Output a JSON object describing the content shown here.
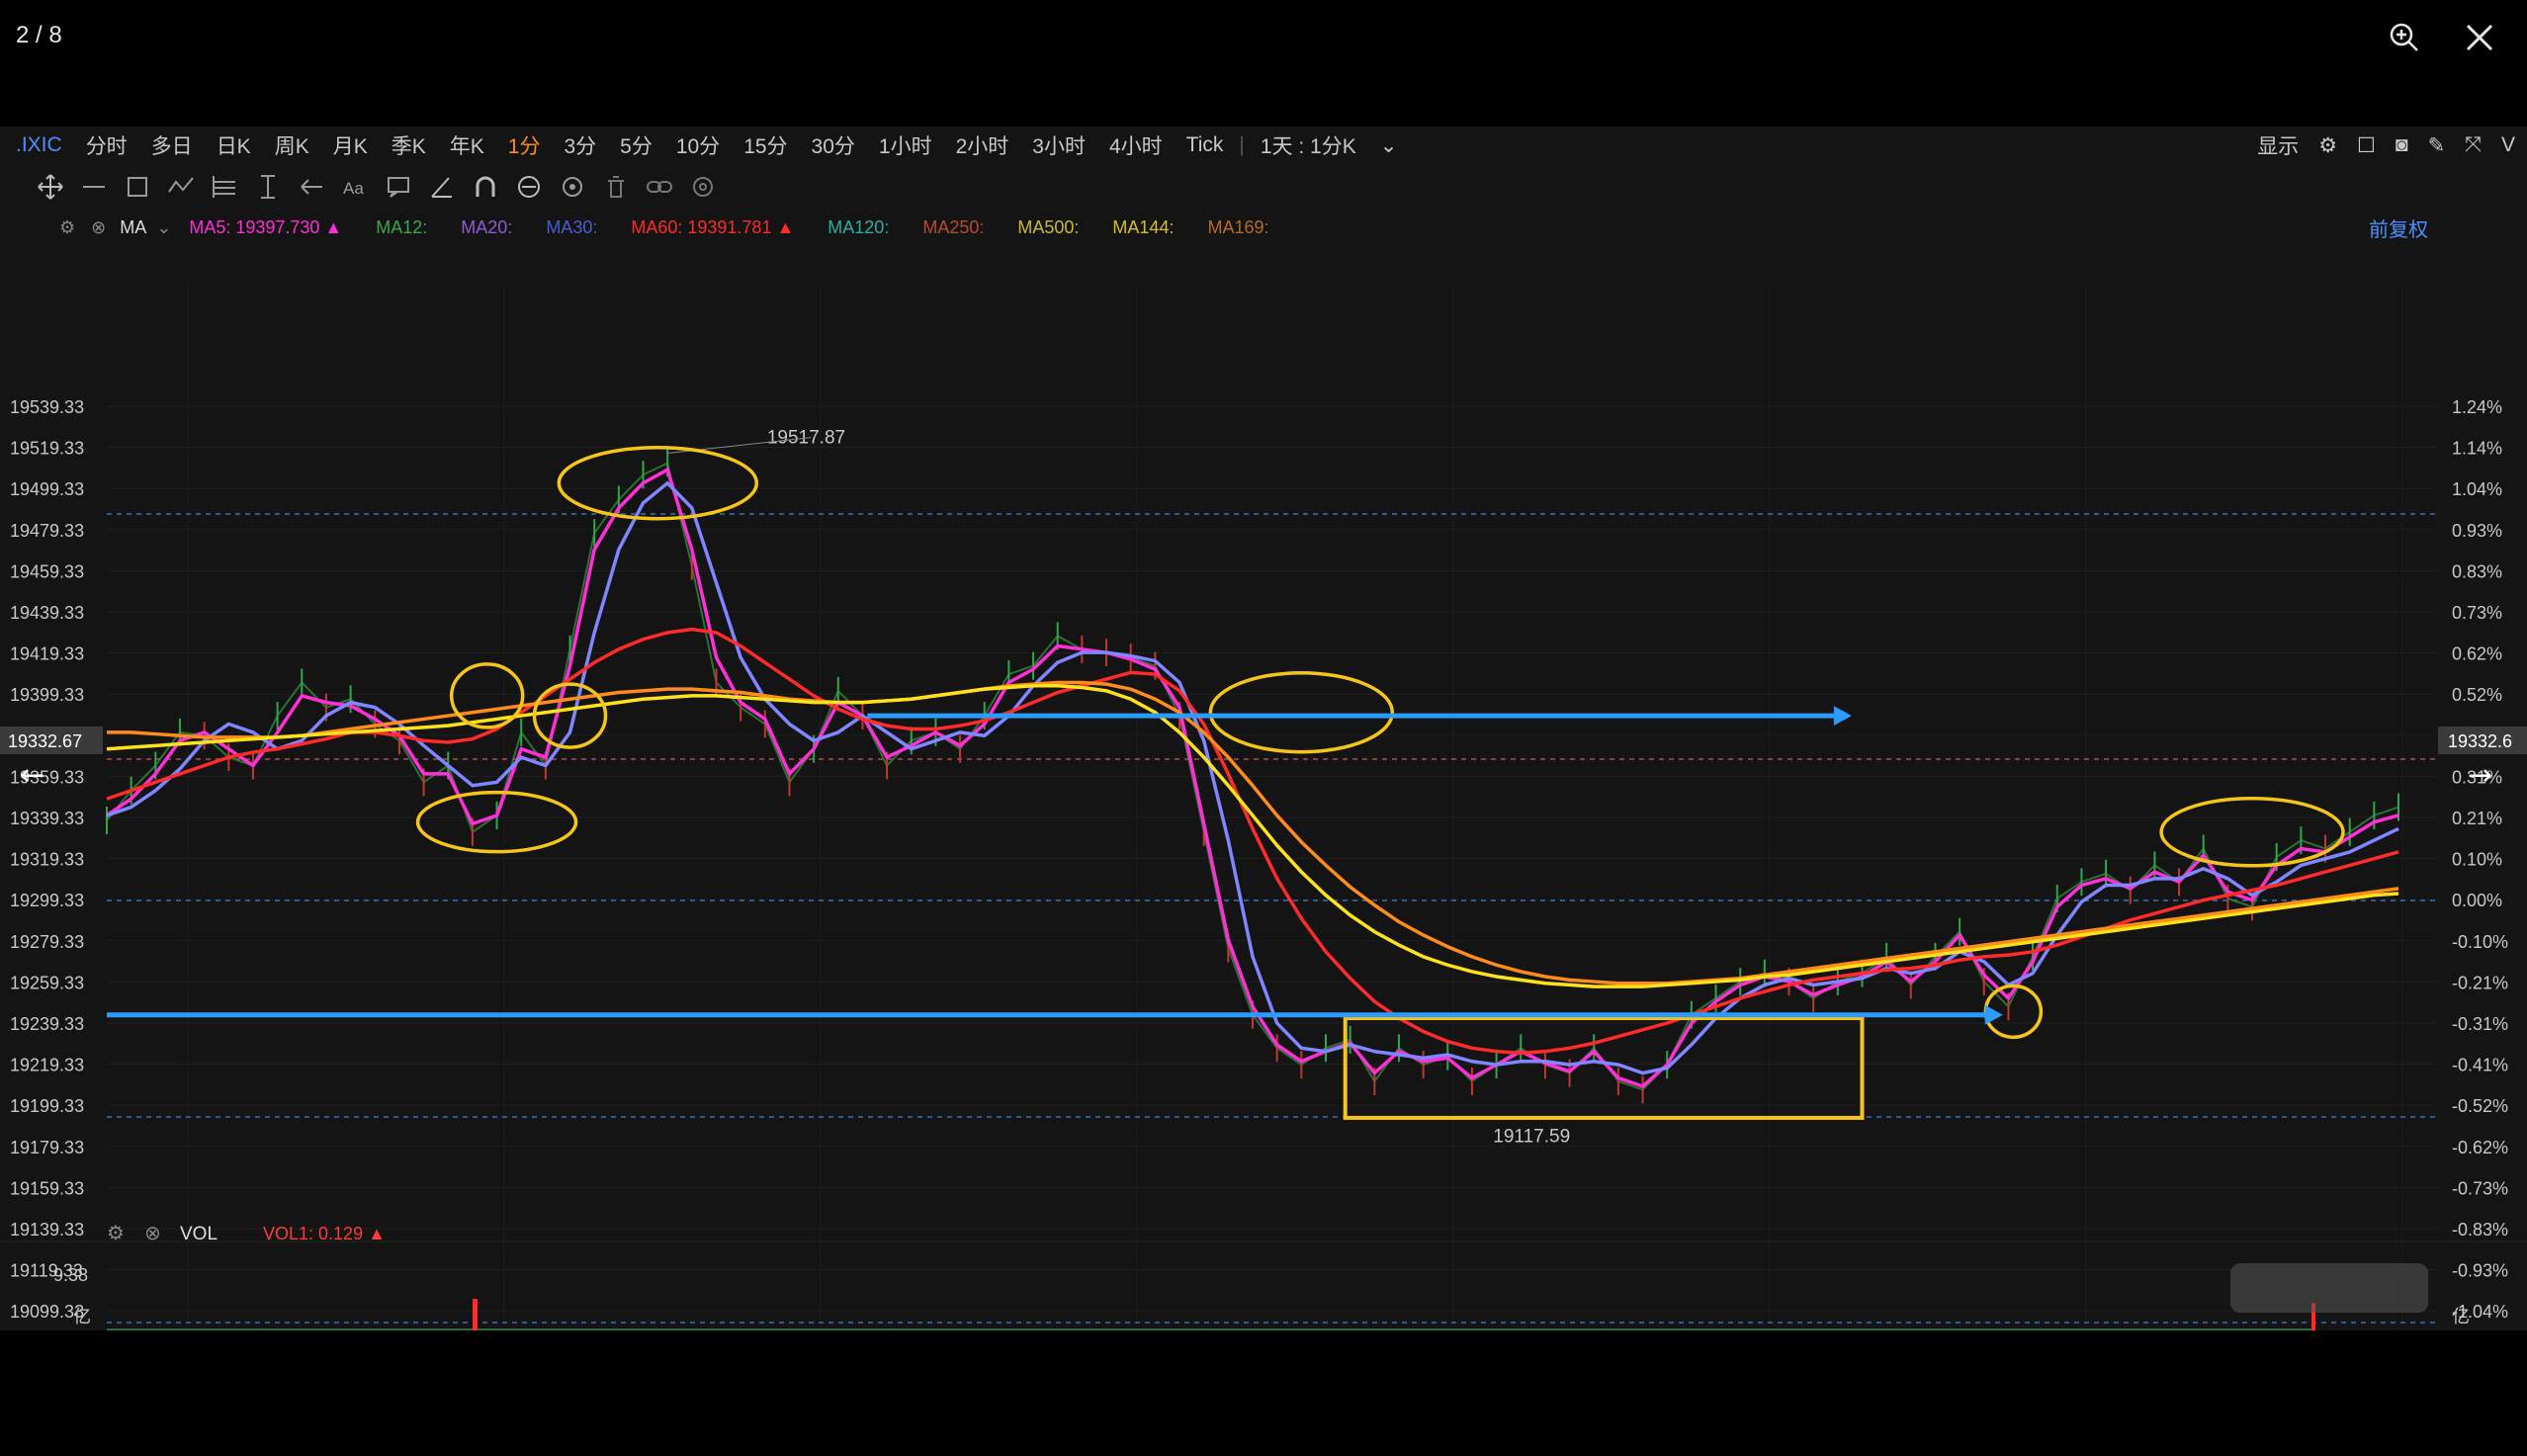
{
  "viewer": {
    "counter": "2 / 8",
    "zoom_icon": "zoom-in-icon",
    "close_icon": "close-icon"
  },
  "toolbar": {
    "symbol": ".IXIC",
    "periods": [
      "分时",
      "多日",
      "日K",
      "周K",
      "月K",
      "季K",
      "年K",
      "1分",
      "3分",
      "5分",
      "10分",
      "15分",
      "30分",
      "1小时",
      "2小时",
      "3小时",
      "4小时",
      "Tick"
    ],
    "active_period": "1分",
    "range": "1天 : 1分K",
    "display_label": "显示"
  },
  "indicator_bar": {
    "name": "MA",
    "items": [
      {
        "label": "MA5: 19397.730 ▲",
        "color": "#ff2fd8"
      },
      {
        "label": "MA12:",
        "color": "#3aa84c"
      },
      {
        "label": "MA20:",
        "color": "#8a5cd6"
      },
      {
        "label": "MA30:",
        "color": "#4a5ad8"
      },
      {
        "label": "MA60: 19391.781 ▲",
        "color": "#ff2a2a"
      },
      {
        "label": "MA120:",
        "color": "#27b0a0"
      },
      {
        "label": "MA250:",
        "color": "#b84a30"
      },
      {
        "label": "MA500:",
        "color": "#c9b830"
      },
      {
        "label": "MA144:",
        "color": "#d4c020"
      },
      {
        "label": "MA169:",
        "color": "#b86a20"
      }
    ],
    "adjust_label": "前复权"
  },
  "volume_bar": {
    "name": "VOL",
    "value_label": "VOL1: 0.129 ▲",
    "max_label": "9.38",
    "unit_label": "亿"
  },
  "chart_data": {
    "type": "line",
    "price_ticks": [
      "19539.33",
      "19519.33",
      "19499.33",
      "19479.33",
      "19459.33",
      "19439.33",
      "19419.33",
      "19399.33",
      "19379.33",
      "19359.33",
      "19339.33",
      "19319.33",
      "19299.33",
      "19279.33",
      "19259.33",
      "19239.33",
      "19219.33",
      "19199.33",
      "19179.33",
      "19159.33",
      "19139.33",
      "19119.33",
      "19099.33"
    ],
    "pct_ticks": [
      "1.24%",
      "1.14%",
      "1.04%",
      "0.93%",
      "0.83%",
      "0.73%",
      "0.62%",
      "0.52%",
      "0.41%",
      "0.31%",
      "0.21%",
      "0.10%",
      "0.00%",
      "-0.10%",
      "-0.21%",
      "-0.31%",
      "-0.41%",
      "-0.52%",
      "-0.62%",
      "-0.73%",
      "-0.83%",
      "-0.93%",
      "-1.04%"
    ],
    "ylim": [
      19090,
      19548
    ],
    "current_price": "19332.67",
    "current_price_right": "19332.6",
    "high_label": "19517.87",
    "low_label": "19117.59",
    "x": [
      0,
      25,
      50,
      75,
      100,
      125,
      150,
      175,
      200,
      225,
      250,
      275,
      300,
      325,
      350,
      375,
      400,
      425,
      450,
      475,
      500,
      525,
      550,
      575,
      600,
      625,
      650,
      675,
      700,
      725,
      750,
      775,
      800,
      825,
      850,
      875,
      900,
      925,
      950,
      975,
      1000,
      1025,
      1050,
      1075,
      1100,
      1125,
      1150,
      1175,
      1200,
      1225,
      1250,
      1275,
      1300,
      1325,
      1350,
      1375,
      1400,
      1425,
      1450,
      1475,
      1500,
      1525,
      1550,
      1575,
      1600,
      1625,
      1650,
      1675,
      1700,
      1725,
      1750,
      1775,
      1800,
      1825,
      1850,
      1875,
      1900,
      1925,
      1950,
      1975,
      2000,
      2025,
      2050,
      2075,
      2100,
      2125,
      2150,
      2175,
      2200,
      2225,
      2250,
      2275,
      2300,
      2325,
      2350
    ],
    "price": [
      19297,
      19315,
      19330,
      19350,
      19348,
      19335,
      19330,
      19360,
      19380,
      19365,
      19370,
      19355,
      19345,
      19320,
      19330,
      19290,
      19300,
      19350,
      19330,
      19400,
      19470,
      19490,
      19505,
      19512,
      19450,
      19380,
      19365,
      19355,
      19320,
      19340,
      19375,
      19360,
      19330,
      19345,
      19350,
      19340,
      19360,
      19385,
      19390,
      19408,
      19400,
      19398,
      19395,
      19390,
      19360,
      19290,
      19220,
      19180,
      19160,
      19150,
      19160,
      19165,
      19140,
      19160,
      19150,
      19155,
      19140,
      19150,
      19160,
      19150,
      19145,
      19160,
      19140,
      19135,
      19150,
      19180,
      19190,
      19200,
      19205,
      19200,
      19190,
      19200,
      19205,
      19215,
      19198,
      19215,
      19230,
      19200,
      19185,
      19215,
      19250,
      19260,
      19265,
      19255,
      19270,
      19260,
      19280,
      19250,
      19245,
      19275,
      19285,
      19280,
      19290,
      19300,
      19305
    ],
    "series": [
      {
        "name": "MA5",
        "color": "#ff2fd8",
        "values": [
          19300,
          19310,
          19325,
          19345,
          19350,
          19340,
          19330,
          19350,
          19372,
          19368,
          19366,
          19358,
          19348,
          19325,
          19325,
          19295,
          19300,
          19340,
          19335,
          19390,
          19460,
          19485,
          19500,
          19508,
          19460,
          19395,
          19368,
          19358,
          19325,
          19340,
          19368,
          19360,
          19335,
          19342,
          19350,
          19342,
          19355,
          19380,
          19388,
          19402,
          19400,
          19398,
          19394,
          19388,
          19365,
          19295,
          19225,
          19185,
          19162,
          19152,
          19158,
          19163,
          19145,
          19158,
          19152,
          19154,
          19142,
          19150,
          19158,
          19151,
          19146,
          19158,
          19142,
          19137,
          19150,
          19175,
          19188,
          19198,
          19203,
          19200,
          19192,
          19198,
          19203,
          19212,
          19200,
          19212,
          19228,
          19204,
          19190,
          19212,
          19245,
          19258,
          19262,
          19256,
          19266,
          19260,
          19276,
          19254,
          19249,
          19270,
          19280,
          19278,
          19287,
          19296,
          19300
        ]
      },
      {
        "name": "MA20",
        "color": "#7f86ff",
        "values": [
          19300,
          19305,
          19315,
          19328,
          19345,
          19355,
          19350,
          19340,
          19345,
          19360,
          19368,
          19365,
          19355,
          19342,
          19330,
          19318,
          19320,
          19335,
          19330,
          19350,
          19410,
          19460,
          19488,
          19500,
          19485,
          19440,
          19395,
          19370,
          19355,
          19345,
          19350,
          19360,
          19350,
          19340,
          19345,
          19350,
          19348,
          19360,
          19378,
          19392,
          19398,
          19398,
          19396,
          19393,
          19380,
          19345,
          19285,
          19215,
          19175,
          19160,
          19158,
          19162,
          19158,
          19156,
          19154,
          19156,
          19152,
          19150,
          19152,
          19152,
          19150,
          19152,
          19150,
          19145,
          19148,
          19162,
          19178,
          19190,
          19198,
          19202,
          19198,
          19200,
          19202,
          19208,
          19205,
          19208,
          19218,
          19212,
          19198,
          19205,
          19228,
          19248,
          19258,
          19258,
          19262,
          19262,
          19268,
          19262,
          19252,
          19260,
          19270,
          19274,
          19278,
          19285,
          19292
        ]
      },
      {
        "name": "MA60",
        "color": "#ff2a2a",
        "values": [
          19310,
          19315,
          19320,
          19325,
          19330,
          19335,
          19338,
          19340,
          19343,
          19346,
          19350,
          19350,
          19348,
          19345,
          19344,
          19346,
          19352,
          19362,
          19372,
          19382,
          19392,
          19400,
          19406,
          19410,
          19412,
          19410,
          19402,
          19392,
          19382,
          19372,
          19364,
          19358,
          19354,
          19352,
          19352,
          19354,
          19357,
          19362,
          19368,
          19374,
          19378,
          19382,
          19386,
          19385,
          19375,
          19355,
          19325,
          19292,
          19262,
          19238,
          19218,
          19202,
          19188,
          19178,
          19170,
          19164,
          19160,
          19158,
          19157,
          19158,
          19160,
          19163,
          19167,
          19171,
          19175,
          19180,
          19185,
          19190,
          19194,
          19198,
          19201,
          19203,
          19205,
          19207,
          19208,
          19210,
          19213,
          19215,
          19216,
          19218,
          19222,
          19227,
          19232,
          19237,
          19241,
          19245,
          19249,
          19252,
          19255,
          19258,
          19262,
          19266,
          19270,
          19274,
          19278
        ]
      },
      {
        "name": "MA144",
        "color": "#ff8c1a",
        "values": [
          19350,
          19350,
          19349,
          19348,
          19347,
          19347,
          19347,
          19347,
          19348,
          19350,
          19352,
          19354,
          19356,
          19358,
          19360,
          19362,
          19364,
          19366,
          19368,
          19370,
          19372,
          19374,
          19375,
          19376,
          19376,
          19375,
          19374,
          19372,
          19370,
          19369,
          19368,
          19368,
          19369,
          19370,
          19372,
          19374,
          19376,
          19378,
          19379,
          19380,
          19380,
          19379,
          19376,
          19370,
          19362,
          19350,
          19335,
          19318,
          19300,
          19284,
          19270,
          19257,
          19246,
          19236,
          19228,
          19221,
          19215,
          19210,
          19206,
          19203,
          19201,
          19200,
          19199,
          19199,
          19199,
          19200,
          19201,
          19202,
          19204,
          19206,
          19208,
          19210,
          19212,
          19214,
          19216,
          19218,
          19220,
          19222,
          19224,
          19226,
          19228,
          19230,
          19232,
          19234,
          19236,
          19238,
          19240,
          19242,
          19244,
          19246,
          19248,
          19250,
          19252,
          19254,
          19256
        ]
      },
      {
        "name": "MA169",
        "color": "#ffe21a",
        "values": [
          19340,
          19341,
          19342,
          19343,
          19344,
          19345,
          19346,
          19347,
          19348,
          19349,
          19350,
          19351,
          19352,
          19353,
          19354,
          19356,
          19358,
          19360,
          19362,
          19364,
          19366,
          19368,
          19370,
          19371,
          19372,
          19372,
          19371,
          19370,
          19369,
          19368,
          19368,
          19368,
          19369,
          19370,
          19372,
          19374,
          19376,
          19377,
          19378,
          19378,
          19377,
          19375,
          19370,
          19362,
          19350,
          19335,
          19318,
          19300,
          19282,
          19266,
          19252,
          19240,
          19230,
          19222,
          19215,
          19210,
          19206,
          19203,
          19201,
          19199,
          19198,
          19197,
          19197,
          19197,
          19198,
          19199,
          19200,
          19201,
          19203,
          19204,
          19206,
          19208,
          19210,
          19212,
          19214,
          19216,
          19218,
          19220,
          19222,
          19224,
          19226,
          19228,
          19230,
          19232,
          19234,
          19236,
          19238,
          19240,
          19242,
          19244,
          19246,
          19248,
          19250,
          19252,
          19253
        ]
      }
    ],
    "annotations": {
      "horizontal_arrows": [
        {
          "y": 19360,
          "x_start": 780,
          "x_end": 1775
        },
        {
          "y": 19180,
          "x_start": 0,
          "x_end": 1930
        }
      ],
      "ellipses": [
        {
          "x": 565,
          "y": 19500,
          "color": "#f5c518"
        },
        {
          "x": 390,
          "y": 19372,
          "color": "#f5c518"
        },
        {
          "x": 475,
          "y": 19360,
          "color": "#f5c518"
        },
        {
          "x": 400,
          "y": 19296,
          "color": "#f5c518"
        },
        {
          "x": 1225,
          "y": 19362,
          "color": "#f5c518"
        },
        {
          "x": 1955,
          "y": 19182,
          "color": "#f5c518"
        },
        {
          "x": 2200,
          "y": 19290,
          "color": "#f5c518"
        }
      ],
      "box": {
        "x_start": 1270,
        "x_end": 1800,
        "y_top": 19178,
        "y_bottom": 19118,
        "color": "#f5c518"
      }
    }
  }
}
